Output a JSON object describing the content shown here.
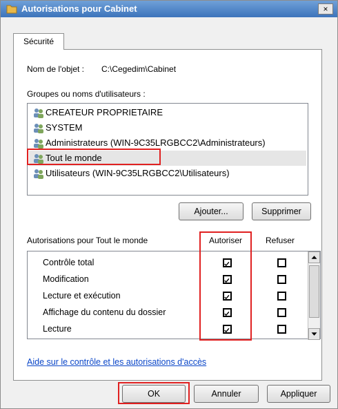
{
  "window": {
    "title": "Autorisations pour Cabinet",
    "close_label": "×"
  },
  "tabs": [
    {
      "label": "Sécurité"
    }
  ],
  "object": {
    "label": "Nom de l'objet :",
    "path": "C:\\Cegedim\\Cabinet"
  },
  "groups_label": "Groupes ou noms d'utilisateurs :",
  "users": [
    {
      "name": "CREATEUR PROPRIETAIRE",
      "icon": "users-icon"
    },
    {
      "name": "SYSTEM",
      "icon": "users-icon"
    },
    {
      "name": "Administrateurs (WIN-9C35LRGBCC2\\Administrateurs)",
      "icon": "users-icon"
    },
    {
      "name": "Tout le monde",
      "icon": "users-icon",
      "selected": true
    },
    {
      "name": "Utilisateurs (WIN-9C35LRGBCC2\\Utilisateurs)",
      "icon": "users-icon"
    }
  ],
  "buttons": {
    "add": "Ajouter...",
    "remove": "Supprimer",
    "ok": "OK",
    "cancel": "Annuler",
    "apply": "Appliquer"
  },
  "permissions": {
    "header": "Autorisations pour Tout le monde",
    "allow_header": "Autoriser",
    "deny_header": "Refuser",
    "rows": [
      {
        "name": "Contrôle total",
        "allow": true,
        "deny": false
      },
      {
        "name": "Modification",
        "allow": true,
        "deny": false
      },
      {
        "name": "Lecture et exécution",
        "allow": true,
        "deny": false
      },
      {
        "name": "Affichage du contenu du dossier",
        "allow": true,
        "deny": false
      },
      {
        "name": "Lecture",
        "allow": true,
        "deny": false
      }
    ]
  },
  "help_link": "Aide sur le contrôle et les autorisations d'accès",
  "colors": {
    "title_bar": "#3d74bb",
    "highlight": "#e02020",
    "link": "#0a46c8"
  }
}
